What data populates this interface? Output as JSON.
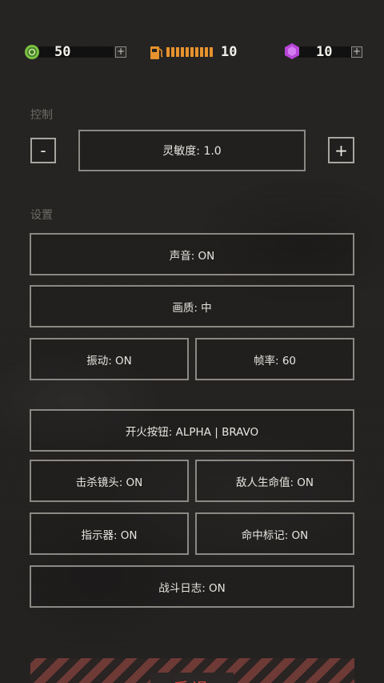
{
  "resources": {
    "coins": {
      "value": "50",
      "icon": "coin-icon",
      "color": "#7ac143"
    },
    "fuel": {
      "value": "10",
      "icon": "fuel-can-icon",
      "color": "#e6922e",
      "segments": 10
    },
    "gems": {
      "value": "10",
      "icon": "gem-icon",
      "color": "#b845d8"
    },
    "plus_label": "+"
  },
  "controls": {
    "section_label": "控制",
    "minus_label": "-",
    "plus_label": "+",
    "sensitivity_label": "灵敏度: 1.0"
  },
  "settings": {
    "section_label": "设置",
    "sound": "声音: ON",
    "quality": "画质: 中",
    "vibration": "振动: ON",
    "framerate": "帧率: 60",
    "fire_button": "开火按钮: ALPHA | BRAVO",
    "kill_cam": "击杀镜头: ON",
    "enemy_health": "敌人生命值: ON",
    "indicator": "指示器: ON",
    "hit_marker": "命中标记: ON",
    "combat_log": "战斗日志: ON"
  },
  "retreat": {
    "label": "后退",
    "accent": "#d24a3f"
  }
}
